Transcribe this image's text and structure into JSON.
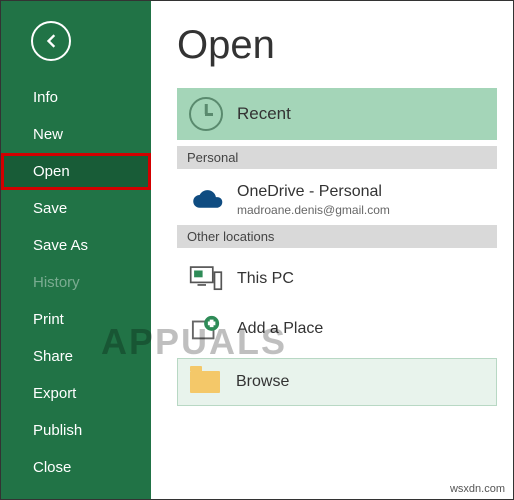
{
  "sidebar": {
    "items": [
      {
        "label": "Info"
      },
      {
        "label": "New"
      },
      {
        "label": "Open"
      },
      {
        "label": "Save"
      },
      {
        "label": "Save As"
      },
      {
        "label": "History"
      },
      {
        "label": "Print"
      },
      {
        "label": "Share"
      },
      {
        "label": "Export"
      },
      {
        "label": "Publish"
      },
      {
        "label": "Close"
      }
    ]
  },
  "page": {
    "title": "Open"
  },
  "recent": {
    "label": "Recent"
  },
  "sections": {
    "personal": "Personal",
    "other": "Other locations"
  },
  "onedrive": {
    "title": "OneDrive - Personal",
    "subtitle": "madroane.denis@gmail.com"
  },
  "thispc": {
    "title": "This PC"
  },
  "addplace": {
    "title": "Add a Place"
  },
  "browse": {
    "label": "Browse"
  },
  "watermark": "APPUALS",
  "footer": "wsxdn.com"
}
